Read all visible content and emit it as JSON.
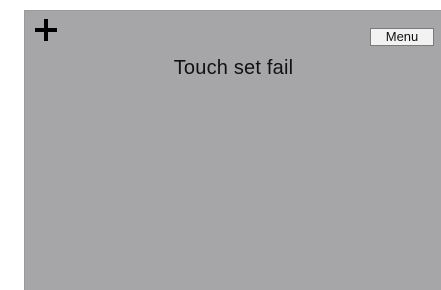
{
  "screen": {
    "message": "Touch set fail",
    "menu_label": "Menu",
    "background_color": "#a6a6a8",
    "touch_target_icon": "crosshair-plus-icon"
  }
}
